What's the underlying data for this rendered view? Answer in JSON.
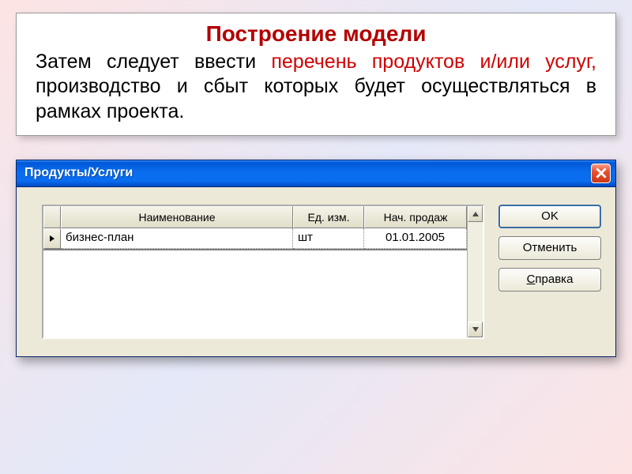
{
  "info": {
    "title": "Построение модели",
    "text_before": "Затем следует ввести ",
    "text_highlight": "перечень продуктов и/или услуг,",
    "text_after": " производство и сбыт которых будет осуществляться в рамках проекта."
  },
  "dialog": {
    "title": "Продукты/Услуги",
    "columns": {
      "name": "Наименование",
      "unit": "Ед. изм.",
      "start": "Нач. продаж"
    },
    "rows": [
      {
        "name": "бизнес-план",
        "unit": "шт",
        "start": "01.01.2005"
      }
    ],
    "buttons": {
      "ok": "OK",
      "cancel": "Отменить",
      "help_prefix": "С",
      "help_rest": "правка"
    }
  }
}
